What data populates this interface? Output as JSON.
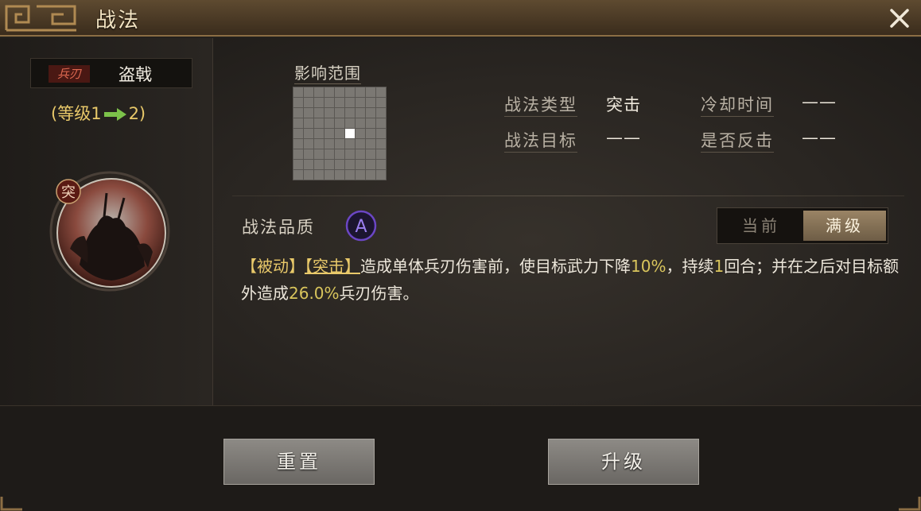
{
  "window": {
    "title": "战法"
  },
  "skill": {
    "troop_badge": "兵刃",
    "name": "盗戟",
    "level_prefix": "(等级1",
    "level_suffix": "2)",
    "type_badge": "突"
  },
  "range": {
    "label": "影响范围",
    "rows": 9,
    "cols": 9,
    "center": [
      4,
      5
    ]
  },
  "info": {
    "type_label": "战法类型",
    "type_value": "突击",
    "cooldown_label": "冷却时间",
    "cooldown_value": "——",
    "target_label": "战法目标",
    "target_value": "——",
    "counter_label": "是否反击",
    "counter_value": "——"
  },
  "quality": {
    "label": "战法品质",
    "grade": "A"
  },
  "toggle": {
    "current": "当前",
    "max": "满级"
  },
  "description": {
    "tag1": "【被动】",
    "tag2": "【突击】",
    "part1": "造成单体兵刃伤害前，使目标武力下降",
    "v1": "10%",
    "part2": "，持续",
    "v2": "1",
    "part3": "回合；并在之后对目标额外造成",
    "v3": "26.0%",
    "part4": "兵刃伤害。"
  },
  "buttons": {
    "reset": "重置",
    "upgrade": "升级"
  },
  "colors": {
    "gold_text": "#e9c96a",
    "highlight": "#d9c55c",
    "quality_purple": "#6b46c4",
    "level_arrow": "#7cc24a",
    "badge_red": "#c0392b"
  }
}
